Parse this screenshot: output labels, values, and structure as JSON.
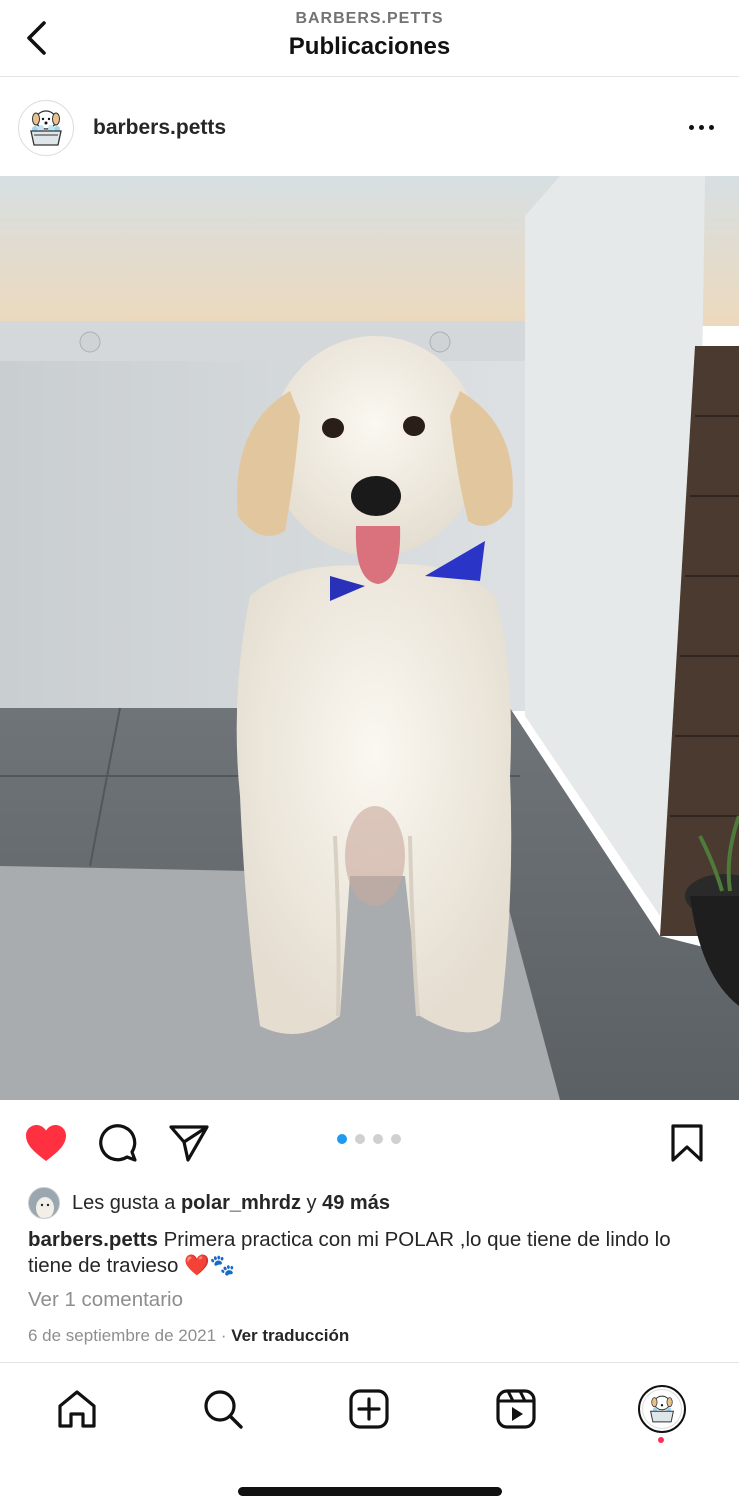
{
  "header": {
    "account_label": "BARBERS.PETTS",
    "title": "Publicaciones"
  },
  "post": {
    "username": "barbers.petts",
    "image_alt_icon": "white-goldendoodle-dog-photo",
    "carousel": {
      "total": 4,
      "active_index": 0
    },
    "likes": {
      "prefix": "Les gusta a ",
      "liker": "polar_mhrdz",
      "joiner": " y ",
      "others": "49 más"
    },
    "caption": {
      "username": "barbers.petts",
      "text": " Primera practica con mi POLAR ,lo que tiene de lindo lo tiene de travieso ❤️🐾"
    },
    "view_comments": "Ver 1 comentario",
    "date": "6 de septiembre de 2021",
    "separator": " · ",
    "translate": "Ver traducción",
    "liked": true
  },
  "colors": {
    "like_red": "#ff3040",
    "carousel_active": "#1d9bf0",
    "carousel_inactive": "#d0d0d0",
    "notification_dot": "#ff2d55"
  },
  "icons": {
    "back": "chevron-left-icon",
    "more": "more-horizontal-icon",
    "like": "heart-filled-icon",
    "comment": "comment-bubble-icon",
    "share": "paper-plane-icon",
    "save": "bookmark-icon",
    "nav": [
      "home-icon",
      "search-icon",
      "create-plus-icon",
      "reels-icon",
      "profile-avatar-icon"
    ]
  }
}
